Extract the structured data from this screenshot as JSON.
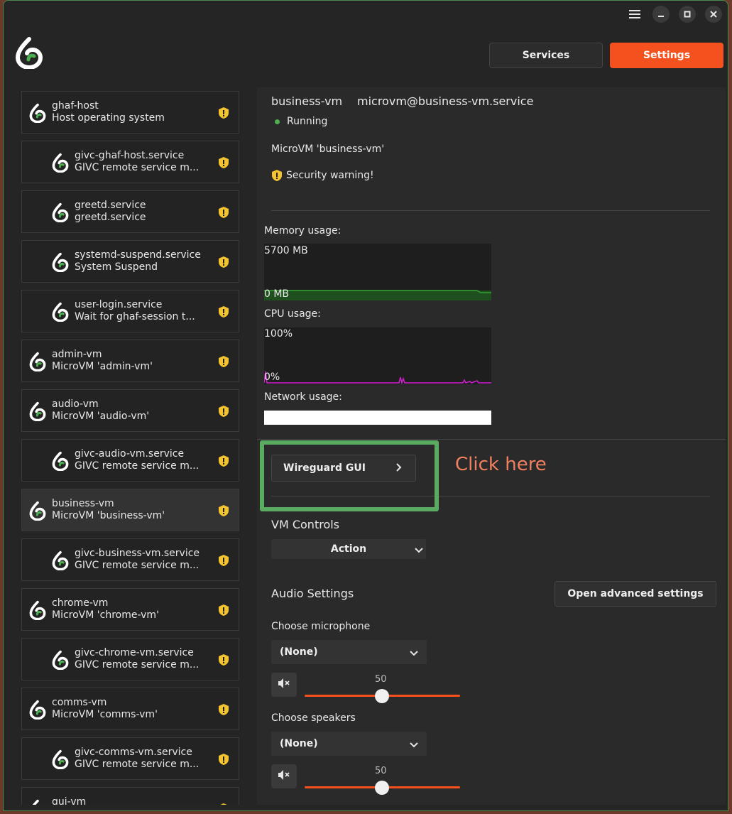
{
  "header": {
    "services_label": "Services",
    "settings_label": "Settings"
  },
  "sidebar": {
    "items": [
      {
        "title": "ghaf-host",
        "subtitle": "Host operating system",
        "indent": false,
        "selected": false,
        "icon": "ghaf-logo-icon",
        "badge": "security-shield-icon"
      },
      {
        "title": "givc-ghaf-host.service",
        "subtitle": "GIVC remote service m...",
        "indent": true,
        "selected": false,
        "icon": "ghaf-logo-icon",
        "badge": "security-shield-icon"
      },
      {
        "title": "greetd.service",
        "subtitle": "greetd.service",
        "indent": true,
        "selected": false,
        "icon": "ghaf-logo-icon",
        "badge": "security-shield-icon"
      },
      {
        "title": "systemd-suspend.service",
        "subtitle": "System Suspend",
        "indent": true,
        "selected": false,
        "icon": "ghaf-logo-icon",
        "badge": "security-shield-icon"
      },
      {
        "title": "user-login.service",
        "subtitle": "Wait for ghaf-session t...",
        "indent": true,
        "selected": false,
        "icon": "ghaf-logo-icon",
        "badge": "security-shield-icon"
      },
      {
        "title": "admin-vm",
        "subtitle": "MicroVM 'admin-vm'",
        "indent": false,
        "selected": false,
        "icon": "ghaf-logo-icon",
        "badge": "security-shield-icon"
      },
      {
        "title": "audio-vm",
        "subtitle": "MicroVM 'audio-vm'",
        "indent": false,
        "selected": false,
        "icon": "ghaf-logo-icon",
        "badge": "security-shield-icon"
      },
      {
        "title": "givc-audio-vm.service",
        "subtitle": "GIVC remote service m...",
        "indent": true,
        "selected": false,
        "icon": "ghaf-logo-icon",
        "badge": "security-shield-icon"
      },
      {
        "title": "business-vm",
        "subtitle": "MicroVM 'business-vm'",
        "indent": false,
        "selected": true,
        "icon": "ghaf-logo-icon",
        "badge": "security-shield-icon"
      },
      {
        "title": "givc-business-vm.service",
        "subtitle": "GIVC remote service m...",
        "indent": true,
        "selected": false,
        "icon": "ghaf-logo-icon",
        "badge": "security-shield-icon"
      },
      {
        "title": "chrome-vm",
        "subtitle": "MicroVM 'chrome-vm'",
        "indent": false,
        "selected": false,
        "icon": "ghaf-logo-icon",
        "badge": "security-shield-icon"
      },
      {
        "title": "givc-chrome-vm.service",
        "subtitle": "GIVC remote service m...",
        "indent": true,
        "selected": false,
        "icon": "ghaf-logo-icon",
        "badge": "security-shield-icon"
      },
      {
        "title": "comms-vm",
        "subtitle": "MicroVM 'comms-vm'",
        "indent": false,
        "selected": false,
        "icon": "ghaf-logo-icon",
        "badge": "security-shield-icon"
      },
      {
        "title": "givc-comms-vm.service",
        "subtitle": "GIVC remote service m...",
        "indent": true,
        "selected": false,
        "icon": "ghaf-logo-icon",
        "badge": "security-shield-icon"
      },
      {
        "title": "gui-vm",
        "subtitle": "",
        "indent": false,
        "selected": false,
        "icon": "ghaf-logo-icon",
        "badge": "security-shield-icon"
      }
    ]
  },
  "detail": {
    "name": "business-vm",
    "service": "microvm@business-vm.service",
    "status": "Running",
    "description": "MicroVM 'business-vm'",
    "warning": "Security warning!",
    "memory_label": "Memory usage:",
    "memory_max": "5700 MB",
    "memory_min": "0 MB",
    "cpu_label": "CPU usage:",
    "cpu_max": "100%",
    "cpu_min": "0%",
    "network_label": "Network usage:",
    "wireguard_label": "Wireguard GUI",
    "vm_controls_label": "VM Controls",
    "action_label": "Action",
    "audio_settings_label": "Audio Settings",
    "advanced_label": "Open advanced settings",
    "microphone_label": "Choose microphone",
    "microphone_value": "(None)",
    "microphone_volume": "50",
    "speakers_label": "Choose speakers",
    "speakers_value": "(None)",
    "speakers_volume": "50"
  },
  "annotation": {
    "click_here": "Click here"
  },
  "colors": {
    "accent": "#f4511e",
    "running": "#4caf50",
    "warning": "#f4c430",
    "highlight": "#5aaa62",
    "memory_graph": "#2e8b2e",
    "cpu_graph": "#d21ed2"
  }
}
